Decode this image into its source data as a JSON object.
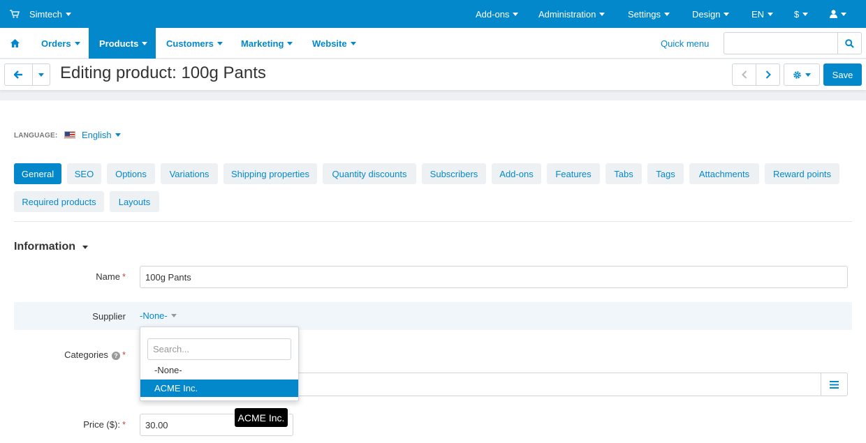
{
  "topbar": {
    "brand": "Simtech",
    "brand_icon": "cart-icon",
    "items": [
      {
        "label": "Add-ons"
      },
      {
        "label": "Administration"
      },
      {
        "label": "Settings"
      },
      {
        "label": "Design"
      },
      {
        "label": "EN"
      },
      {
        "label": "$"
      },
      {
        "label": "",
        "icon": "user-icon"
      }
    ]
  },
  "mainnav": {
    "home_icon": "home-icon",
    "items": [
      {
        "label": "Orders",
        "active": false
      },
      {
        "label": "Products",
        "active": true
      },
      {
        "label": "Customers",
        "active": false
      },
      {
        "label": "Marketing",
        "active": false
      },
      {
        "label": "Website",
        "active": false
      }
    ],
    "quick_menu": "Quick menu",
    "search": {
      "value": "",
      "icon": "search-icon"
    }
  },
  "titlebar": {
    "title": "Editing product: 100g Pants",
    "save_label": "Save"
  },
  "language": {
    "label": "LANGUAGE:",
    "value": "English",
    "flag": "us-flag-icon"
  },
  "tabs": [
    {
      "label": "General",
      "active": true
    },
    {
      "label": "SEO"
    },
    {
      "label": "Options"
    },
    {
      "label": "Variations"
    },
    {
      "label": "Shipping properties"
    },
    {
      "label": "Quantity discounts"
    },
    {
      "label": "Subscribers"
    },
    {
      "label": "Add-ons"
    },
    {
      "label": "Features"
    },
    {
      "label": "Tabs"
    },
    {
      "label": "Tags"
    },
    {
      "label": "Attachments"
    },
    {
      "label": "Reward points"
    },
    {
      "label": "Required products"
    },
    {
      "label": "Layouts"
    }
  ],
  "section": {
    "title": "Information"
  },
  "fields": {
    "name": {
      "label": "Name",
      "required": "*",
      "value": "100g Pants"
    },
    "supplier": {
      "label": "Supplier",
      "value": "-None-"
    },
    "categories": {
      "label": "Categories",
      "required": "*",
      "help": "?"
    },
    "price": {
      "label": "Price ($):",
      "required": "*",
      "value": "30.00"
    }
  },
  "supplier_dropdown": {
    "search_placeholder": "Search...",
    "options": [
      {
        "label": "-None-",
        "selected": false
      },
      {
        "label": "ACME Inc.",
        "selected": true
      }
    ]
  },
  "tooltip": "ACME Inc.",
  "colors": {
    "accent": "#0388cc",
    "highlight_row": "#f1f6fb"
  }
}
